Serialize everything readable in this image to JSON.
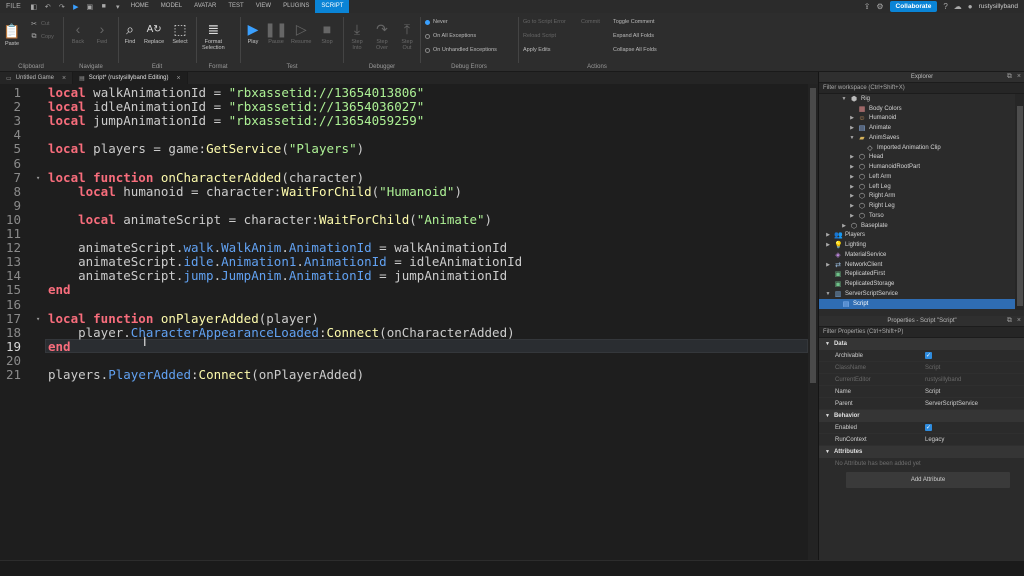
{
  "menubar": {
    "items": [
      "FILE",
      "HOME",
      "MODEL",
      "AVATAR",
      "TEST",
      "VIEW",
      "PLUGINS",
      "SCRIPT"
    ],
    "active": "SCRIPT",
    "collaborate": "Collaborate",
    "username": "rustysillyband"
  },
  "ribbon": {
    "clipboard": {
      "label": "Clipboard",
      "paste": "Paste",
      "cut": "Cut",
      "copy": "Copy"
    },
    "navigate": {
      "label": "Navigate",
      "back": "Back",
      "fwd": "Fwd"
    },
    "edit": {
      "label": "Edit",
      "find": "Find",
      "replace": "Replace",
      "select": "Select"
    },
    "format": {
      "label": "Format",
      "format_selection": "Format\nSelection"
    },
    "test": {
      "label": "Test",
      "play": "Play",
      "pause": "Pause",
      "resume": "Resume",
      "stop": "Stop"
    },
    "debugger": {
      "label": "Debugger",
      "step_into": "Step\nInto",
      "step_over": "Step\nOver",
      "step_out": "Step\nOut"
    },
    "debug_errors": {
      "label": "Debug Errors",
      "never": "Never",
      "all": "On All Exceptions",
      "unhandled": "On Unhandled Exceptions"
    },
    "actions": {
      "label": "Actions",
      "go_to": "Go to Script Error",
      "commit": "Commit",
      "reload": "Reload Script",
      "apply": "Apply Edits",
      "toggle": "Toggle Comment",
      "expand": "Expand All Folds",
      "collapse": "Collapse All Folds"
    }
  },
  "tabs": [
    {
      "label": "Untitled Game"
    },
    {
      "label": "Script* (rustysillyband Editing)"
    }
  ],
  "code": {
    "lines": [
      [
        [
          "kw",
          "local"
        ],
        [
          "id",
          " walkAnimationId = "
        ],
        [
          "str",
          "\"rbxassetid://13654013806\""
        ]
      ],
      [
        [
          "kw",
          "local"
        ],
        [
          "id",
          " idleAnimationId = "
        ],
        [
          "str",
          "\"rbxassetid://13654036027\""
        ]
      ],
      [
        [
          "kw",
          "local"
        ],
        [
          "id",
          " jumpAnimationId = "
        ],
        [
          "str",
          "\"rbxassetid://13654059259\""
        ]
      ],
      [],
      [
        [
          "kw",
          "local"
        ],
        [
          "id",
          " players = game:"
        ],
        [
          "fn",
          "GetService"
        ],
        [
          "id",
          "("
        ],
        [
          "str",
          "\"Players\""
        ],
        [
          "id",
          ")"
        ]
      ],
      [],
      [
        [
          "kw",
          "local function"
        ],
        [
          "id",
          " "
        ],
        [
          "fn",
          "onCharacterAdded"
        ],
        [
          "id",
          "(character)"
        ]
      ],
      [
        [
          "id",
          "    "
        ],
        [
          "kw",
          "local"
        ],
        [
          "id",
          " humanoid = character:"
        ],
        [
          "fn",
          "WaitForChild"
        ],
        [
          "id",
          "("
        ],
        [
          "str",
          "\"Humanoid\""
        ],
        [
          "id",
          ")"
        ]
      ],
      [],
      [
        [
          "id",
          "    "
        ],
        [
          "kw",
          "local"
        ],
        [
          "id",
          " animateScript = character:"
        ],
        [
          "fn",
          "WaitForChild"
        ],
        [
          "id",
          "("
        ],
        [
          "str",
          "\"Animate\""
        ],
        [
          "id",
          ")"
        ]
      ],
      [],
      [
        [
          "id",
          "    animateScript."
        ],
        [
          "prop",
          "walk"
        ],
        [
          "id",
          "."
        ],
        [
          "prop",
          "WalkAnim"
        ],
        [
          "id",
          "."
        ],
        [
          "prop",
          "AnimationId"
        ],
        [
          "id",
          " = walkAnimationId"
        ]
      ],
      [
        [
          "id",
          "    animateScript."
        ],
        [
          "prop",
          "idle"
        ],
        [
          "id",
          "."
        ],
        [
          "prop",
          "Animation1"
        ],
        [
          "id",
          "."
        ],
        [
          "prop",
          "AnimationId"
        ],
        [
          "id",
          " = idleAnimationId"
        ]
      ],
      [
        [
          "id",
          "    animateScript."
        ],
        [
          "prop",
          "jump"
        ],
        [
          "id",
          "."
        ],
        [
          "prop",
          "JumpAnim"
        ],
        [
          "id",
          "."
        ],
        [
          "prop",
          "AnimationId"
        ],
        [
          "id",
          " = jumpAnimationId"
        ]
      ],
      [
        [
          "kw",
          "end"
        ]
      ],
      [],
      [
        [
          "kw",
          "local function"
        ],
        [
          "id",
          " "
        ],
        [
          "fn",
          "onPlayerAdded"
        ],
        [
          "id",
          "(player)"
        ]
      ],
      [
        [
          "id",
          "    player."
        ],
        [
          "prop",
          "CharacterAppearanceLoaded"
        ],
        [
          "id",
          ":"
        ],
        [
          "fn",
          "Connect"
        ],
        [
          "id",
          "(onCharacterAdded)"
        ]
      ],
      [
        [
          "kw",
          "end"
        ]
      ],
      [],
      [
        [
          "id",
          "players."
        ],
        [
          "prop",
          "PlayerAdded"
        ],
        [
          "id",
          ":"
        ],
        [
          "fn",
          "Connect"
        ],
        [
          "id",
          "(onPlayerAdded)"
        ]
      ]
    ],
    "current_line": 19
  },
  "explorer": {
    "title": "Explorer",
    "filter": "Filter workspace (Ctrl+Shift+X)",
    "items": [
      {
        "label": "Rig",
        "indent": 2,
        "icon": "model-icon",
        "toggle": "down"
      },
      {
        "label": "Body Colors",
        "indent": 3,
        "icon": "body-colors-icon",
        "toggle": ""
      },
      {
        "label": "Humanoid",
        "indent": 3,
        "icon": "humanoid-icon",
        "toggle": "right"
      },
      {
        "label": "Animate",
        "indent": 3,
        "icon": "script-icon",
        "toggle": "right"
      },
      {
        "label": "AnimSaves",
        "indent": 3,
        "icon": "folder-icon",
        "toggle": "down"
      },
      {
        "label": "Imported Animation Clip",
        "indent": 4,
        "icon": "animation-icon",
        "toggle": ""
      },
      {
        "label": "Head",
        "indent": 3,
        "icon": "part-icon",
        "toggle": "right"
      },
      {
        "label": "HumanoidRootPart",
        "indent": 3,
        "icon": "part-icon",
        "toggle": "right"
      },
      {
        "label": "Left Arm",
        "indent": 3,
        "icon": "part-icon",
        "toggle": "right"
      },
      {
        "label": "Left Leg",
        "indent": 3,
        "icon": "part-icon",
        "toggle": "right"
      },
      {
        "label": "Right Arm",
        "indent": 3,
        "icon": "part-icon",
        "toggle": "right"
      },
      {
        "label": "Right Leg",
        "indent": 3,
        "icon": "part-icon",
        "toggle": "right"
      },
      {
        "label": "Torso",
        "indent": 3,
        "icon": "part-icon",
        "toggle": "right"
      },
      {
        "label": "Baseplate",
        "indent": 2,
        "icon": "part-icon",
        "toggle": "right"
      },
      {
        "label": "Players",
        "indent": 0,
        "icon": "players-icon",
        "toggle": "right"
      },
      {
        "label": "Lighting",
        "indent": 0,
        "icon": "lighting-icon",
        "toggle": "right"
      },
      {
        "label": "MaterialService",
        "indent": 0,
        "icon": "material-icon",
        "toggle": ""
      },
      {
        "label": "NetworkClient",
        "indent": 0,
        "icon": "network-icon",
        "toggle": "right"
      },
      {
        "label": "ReplicatedFirst",
        "indent": 0,
        "icon": "replicated-icon",
        "toggle": ""
      },
      {
        "label": "ReplicatedStorage",
        "indent": 0,
        "icon": "replicated-icon",
        "toggle": ""
      },
      {
        "label": "ServerScriptService",
        "indent": 0,
        "icon": "server-script-icon",
        "toggle": "down"
      },
      {
        "label": "Script",
        "indent": 1,
        "icon": "script-icon",
        "toggle": "",
        "selected": true
      }
    ]
  },
  "properties": {
    "title": "Properties - Script \"Script\"",
    "filter": "Filter Properties (Ctrl+Shift+P)",
    "sections": [
      {
        "name": "Data",
        "rows": [
          {
            "name": "Archivable",
            "value": "",
            "checkbox": true,
            "dim": false
          },
          {
            "name": "ClassName",
            "value": "Script",
            "dim": true
          },
          {
            "name": "CurrentEditor",
            "value": "rustysillyband",
            "dim": true
          },
          {
            "name": "Name",
            "value": "Script",
            "dim": false
          },
          {
            "name": "Parent",
            "value": "ServerScriptService",
            "dim": false
          }
        ]
      },
      {
        "name": "Behavior",
        "rows": [
          {
            "name": "Enabled",
            "value": "",
            "checkbox": true,
            "dim": false
          },
          {
            "name": "RunContext",
            "value": "Legacy",
            "dim": false
          }
        ]
      },
      {
        "name": "Attributes",
        "rows": []
      }
    ],
    "no_attr": "No Attribute has been added yet",
    "add_attr": "Add Attribute"
  },
  "colors": {
    "accent": "#0a84d6",
    "keyword": "#f86d7c",
    "string": "#adf195",
    "function": "#fdfbac",
    "property": "#61a1f1",
    "selection": "#2f6db3"
  }
}
